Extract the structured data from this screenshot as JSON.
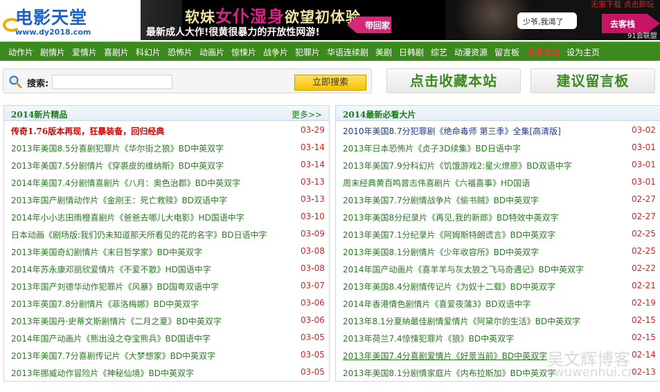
{
  "logo": {
    "name": "电影天堂",
    "url": "www.dy2018.com"
  },
  "banner": {
    "headline_pre": "软妹",
    "headline_highlight": "女仆湿身",
    "headline_post": "欲望初体验",
    "subline": "最新成人大作!很黄很暴力的开放性网游!",
    "back_button": "带回家",
    "bubble_text": "少爷,我渴了",
    "go_button": "去客栈",
    "top_right": "无需下载 点击即玩",
    "footer": "91会联盟"
  },
  "nav": {
    "items": [
      {
        "label": "动作片"
      },
      {
        "label": "剧情片"
      },
      {
        "label": "爱情片"
      },
      {
        "label": "喜剧片"
      },
      {
        "label": "科幻片"
      },
      {
        "label": "恐怖片"
      },
      {
        "label": "动画片"
      },
      {
        "label": "惊悚片"
      },
      {
        "label": "战争片"
      },
      {
        "label": "犯罪片"
      },
      {
        "label": "华语连续剧"
      },
      {
        "label": "美剧"
      },
      {
        "label": "日韩剧"
      },
      {
        "label": "综艺"
      },
      {
        "label": "动漫资源"
      },
      {
        "label": "留言板"
      },
      {
        "label": "收藏本站"
      },
      {
        "label": "设为主页"
      }
    ],
    "active_index": 16
  },
  "search": {
    "label": "搜索:",
    "value": "",
    "placeholder": "",
    "button": "立即搜索"
  },
  "actions": {
    "bookmark": "点击收藏本站",
    "guestbook": "建议留言板"
  },
  "left_panel": {
    "title": "2014新片精品",
    "more": "更多>>",
    "rows": [
      {
        "title": "传奇1.76版本再现，狂暴装备，回归经典",
        "date": "03-29",
        "style": "hot"
      },
      {
        "title": "2013年美国8.5分喜剧犯罪片《华尔街之狼》BD中英双字",
        "date": "03-14"
      },
      {
        "title": "2013年美国7.5分剧情片《穿裘皮的维纳斯》BD中英双字",
        "date": "03-14"
      },
      {
        "title": "2014年美国7.4分剧情喜剧片《八月：奥色治郡》BD中英双字",
        "date": "03-13"
      },
      {
        "title": "2013年国产剧情动作片《金刚王：死亡救赎》BD双语中字",
        "date": "03-13"
      },
      {
        "title": "2014年小小志田雨橙喜剧片《爸爸去哪儿大电影》HD国语中字",
        "date": "03-10"
      },
      {
        "title": "日本动画《剧场版:我们仍未知道那天所看见的花的名字》BD日语中字",
        "date": "03-09"
      },
      {
        "title": "2013年美国奇幻剧情片《末日哲学家》BD中英双字",
        "date": "03-08"
      },
      {
        "title": "2014年苏永康邓丽欣爱情片《不爱不散》HD国语中字",
        "date": "03-08"
      },
      {
        "title": "2013年国产刘德华动作犯罪片《风暴》BD国粤双语中字",
        "date": "03-07"
      },
      {
        "title": "2013年英国7.8分剧情片《菲洛梅娜》BD中英双字",
        "date": "03-06"
      },
      {
        "title": "2013年美国丹·史蒂文斯剧情片《二月之夏》BD中英双字",
        "date": "03-06"
      },
      {
        "title": "2014年国产动画片《熊出没之夺宝熊兵》BD国语中字",
        "date": "03-05"
      },
      {
        "title": "2013年美国7.7分喜剧传记片《大梦想家》BD中英双字",
        "date": "03-05"
      },
      {
        "title": "2013年挪威动作冒险片《神秘仙境》BD中英双字",
        "date": "03-05"
      }
    ]
  },
  "right_panel": {
    "title": "2014最新必看大片",
    "rows": [
      {
        "title": "2010年美国8.7分犯罪剧《绝命毒师 第三季》全集[高清版]",
        "date": "03-02",
        "style": "navy"
      },
      {
        "title": "2013年日本恐怖片《贞子3D续集》BD日语中字",
        "date": "03-01"
      },
      {
        "title": "2013年美国7.9分科幻片《饥饿游戏2:星火燎原》BD双语中字",
        "date": "03-01"
      },
      {
        "title": "周末经典黄百鸣曾志伟喜剧片《六福喜事》HD国语",
        "date": "03-01"
      },
      {
        "title": "2013年美国7.7分剧情战争片《偷书贼》BD中英双字",
        "date": "02-27"
      },
      {
        "title": "2013年美国8分纪录片《再见,我的新郎》BD特效中英双字",
        "date": "02-27"
      },
      {
        "title": "2013年美国7.1分纪录片《阿姆斯特朗谎言》BD中英双字",
        "date": "02-25"
      },
      {
        "title": "2013年美国8.1分剧情片《少年收容所》BD中英双字",
        "date": "02-25"
      },
      {
        "title": "2014年国产动画片《喜羊羊与灰太狼之飞马奇遇记》BD中英双字",
        "date": "02-22"
      },
      {
        "title": "2013年美国8.4分剧情传记片《为奴十二载》BD中英双字",
        "date": "02-21"
      },
      {
        "title": "2014年香港情色剧情片《喜爱夜蒲3》BD双语中字",
        "date": "02-19"
      },
      {
        "title": "2013年8.1分夏納最佳剧情爱情片《阿黛尔的生活》BD中英双字",
        "date": "02-15"
      },
      {
        "title": "2013年荷兰7.4惊悚犯罪片《狼》BD中英双字",
        "date": "02-15"
      },
      {
        "title": "2013年美国7.4分喜剧爱情片《好景当前》BD中英双字",
        "date": "02-14",
        "style": "ul"
      },
      {
        "title": "2013年美国8.1分剧情家庭片《内布拉斯加》BD中英双字",
        "date": "02-13"
      }
    ]
  },
  "watermark": {
    "line1": "吴文辉博客",
    "line2": "wuwenhui.cn"
  }
}
